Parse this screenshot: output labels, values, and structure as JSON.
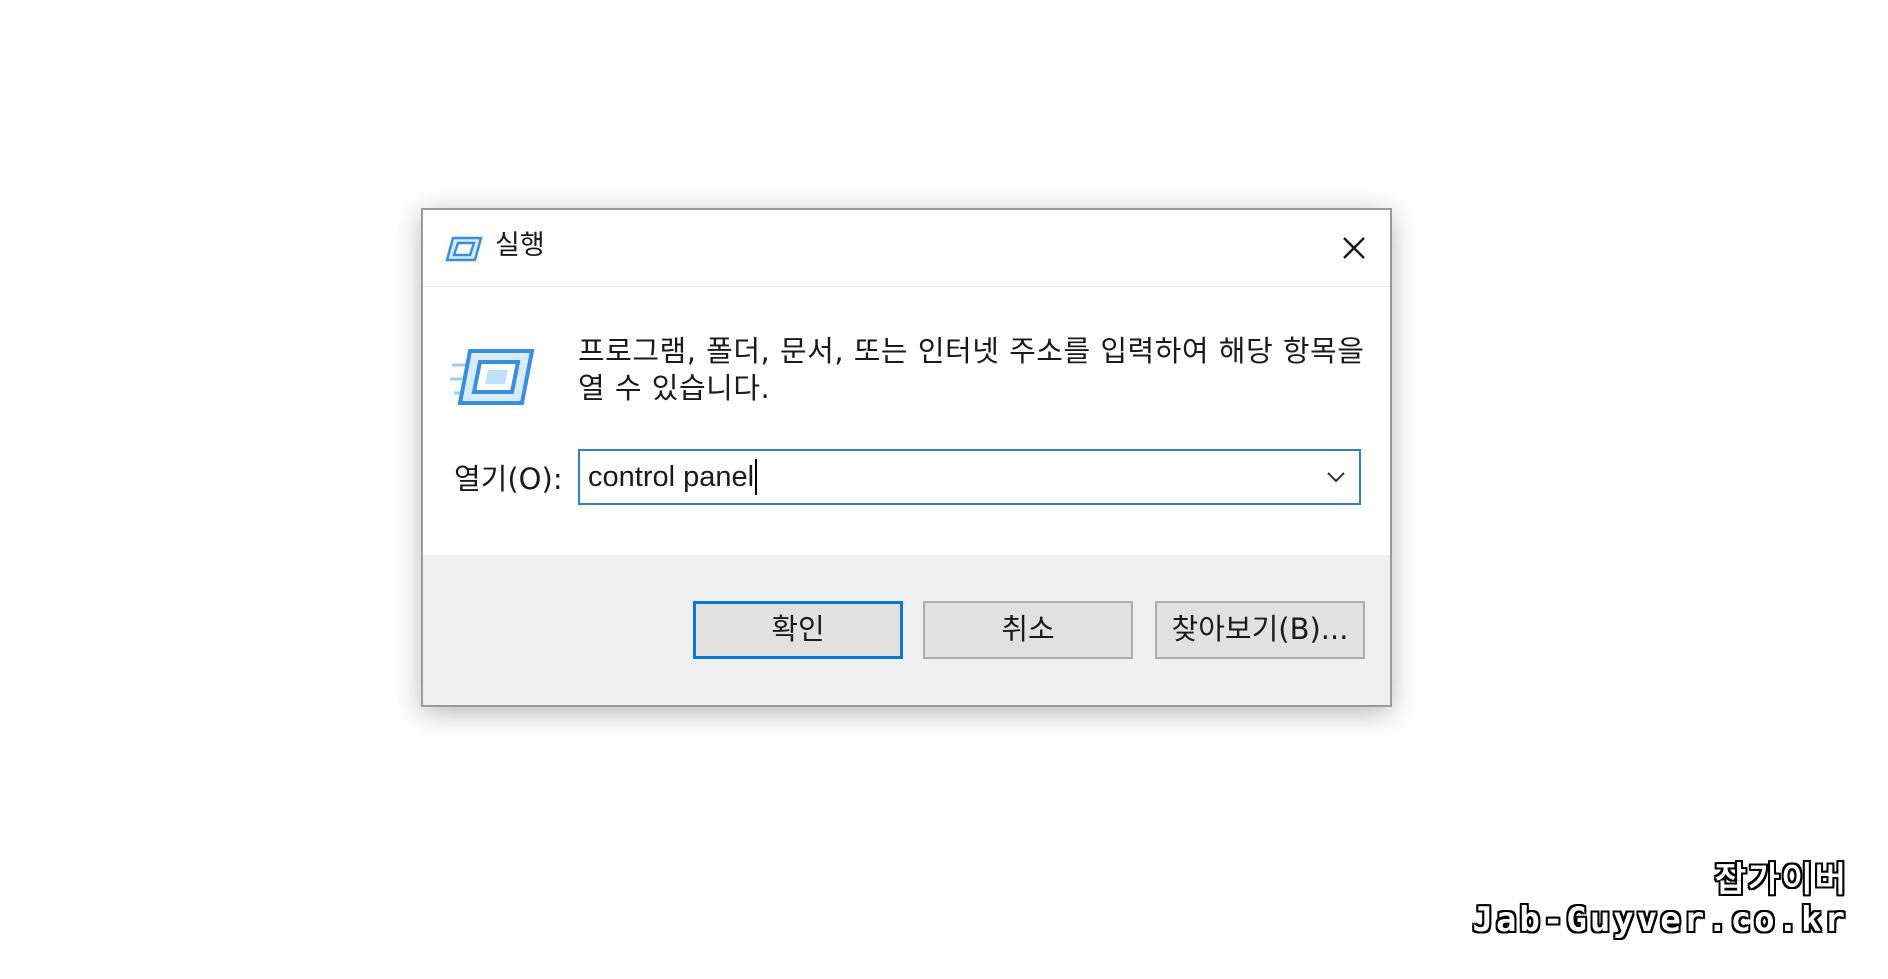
{
  "dialog": {
    "title": "실행",
    "description": "프로그램, 폴더, 문서, 또는 인터넷 주소를 입력하여 해당 항목을 열 수 있습니다.",
    "open_label": "열기(O):",
    "input_value": "control panel",
    "buttons": {
      "ok": "확인",
      "cancel": "취소",
      "browse": "찾아보기(B)..."
    }
  },
  "watermark": {
    "line1": "잡가이버",
    "line2": "Jab-Guyver.co.kr"
  },
  "colors": {
    "focus_border": "#2f7fd1",
    "default_button_border": "#0a78d7",
    "footer_bg": "#f0f0f0",
    "icon_blue": "#3a8fdc"
  },
  "icons": {
    "title": "run-app-icon",
    "big": "run-app-icon",
    "close": "close-icon",
    "dropdown": "chevron-down-icon"
  }
}
